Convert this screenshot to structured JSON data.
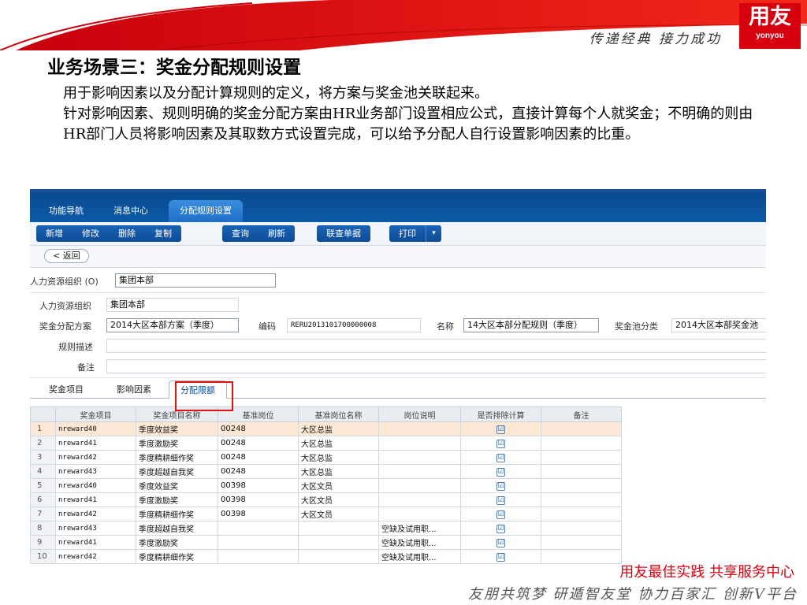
{
  "header": {
    "slogan": "传递经典  接力成功",
    "logo_main": "用友",
    "logo_sub": "yonyou"
  },
  "slide": {
    "title": "业务场景三：奖金分配规则设置",
    "paragraphs": [
      "用于影响因素以及分配计算规则的定义，将方案与奖金池关联起来。",
      "针对影响因素、规则明确的奖金分配方案由HR业务部门设置相应公式，直接计算每个人就奖金；不明确的则由HR部门人员将影响因素及其取数方式设置完成，可以给予分配人自行设置影响因素的比重。"
    ]
  },
  "app": {
    "tabs": [
      "功能导航",
      "消息中心",
      "分配规则设置"
    ],
    "toolbar_group1": [
      "新增",
      "修改",
      "删除",
      "复制"
    ],
    "toolbar_group2": [
      "查询",
      "刷新"
    ],
    "toolbar_group3": [
      "联查单据"
    ],
    "toolbar_group4": [
      "打印"
    ],
    "dropdown_glyph": "▾",
    "back_label": "< 返回",
    "org_filter_label": "人力资源组织 (O)",
    "org_filter_value": "集团本部",
    "form": {
      "org_label": "人力资源组织",
      "org_value": "集团本部",
      "scheme_label": "奖金分配方案",
      "scheme_value": "2014大区本部方案（季度）",
      "code_label": "编码",
      "code_value": "RERU2013101700000008",
      "name_label": "名称",
      "name_value": "14大区本部分配规则（季度）",
      "pool_label": "奖金池分类",
      "pool_value": "2014大区本部奖金池",
      "desc_label": "规则描述",
      "desc_value": "",
      "remark_label": "备注",
      "remark_value": ""
    },
    "subtabs": [
      "奖金项目",
      "影响因素",
      "分配限额"
    ],
    "grid": {
      "columns": [
        "",
        "奖金项目",
        "奖金项目名称",
        "基准岗位",
        "基准岗位名称",
        "岗位说明",
        "是否排除计算",
        "备注"
      ],
      "rows": [
        {
          "n": "1",
          "item": "nreward40",
          "name": "季度效益奖",
          "post": "00248",
          "post_name": "大区总监",
          "desc": "",
          "excl": "☑",
          "remark": ""
        },
        {
          "n": "2",
          "item": "nreward41",
          "name": "季度激励奖",
          "post": "00248",
          "post_name": "大区总监",
          "desc": "",
          "excl": "☑",
          "remark": ""
        },
        {
          "n": "3",
          "item": "nreward42",
          "name": "季度精耕细作奖",
          "post": "00248",
          "post_name": "大区总监",
          "desc": "",
          "excl": "☑",
          "remark": ""
        },
        {
          "n": "4",
          "item": "nreward43",
          "name": "季度超越自我奖",
          "post": "00248",
          "post_name": "大区总监",
          "desc": "",
          "excl": "☑",
          "remark": ""
        },
        {
          "n": "5",
          "item": "nreward40",
          "name": "季度效益奖",
          "post": "00398",
          "post_name": "大区文员",
          "desc": "",
          "excl": "☑",
          "remark": ""
        },
        {
          "n": "6",
          "item": "nreward41",
          "name": "季度激励奖",
          "post": "00398",
          "post_name": "大区文员",
          "desc": "",
          "excl": "☑",
          "remark": ""
        },
        {
          "n": "7",
          "item": "nreward42",
          "name": "季度精耕细作奖",
          "post": "00398",
          "post_name": "大区文员",
          "desc": "",
          "excl": "☑",
          "remark": ""
        },
        {
          "n": "8",
          "item": "nreward43",
          "name": "季度超越自我奖",
          "post": "",
          "post_name": "",
          "desc": "空缺及试用职...",
          "excl": "☑",
          "remark": ""
        },
        {
          "n": "9",
          "item": "nreward41",
          "name": "季度激励奖",
          "post": "",
          "post_name": "",
          "desc": "空缺及试用职...",
          "excl": "☑",
          "remark": ""
        },
        {
          "n": "10",
          "item": "nreward42",
          "name": "季度精耕细作奖",
          "post": "",
          "post_name": "",
          "desc": "空缺及试用职...",
          "excl": "☑",
          "remark": ""
        }
      ]
    }
  },
  "footer": {
    "slogan": "用友最佳实践  共享服务中心",
    "bottom": "友朋共筑梦  研遁智友堂  协力百家汇  创新V平台"
  },
  "colors": {
    "brand_red": "#d7000f",
    "app_blue": "#0c5aa8",
    "highlight_box": "#e01010",
    "selected_row": "#fde8d5"
  }
}
